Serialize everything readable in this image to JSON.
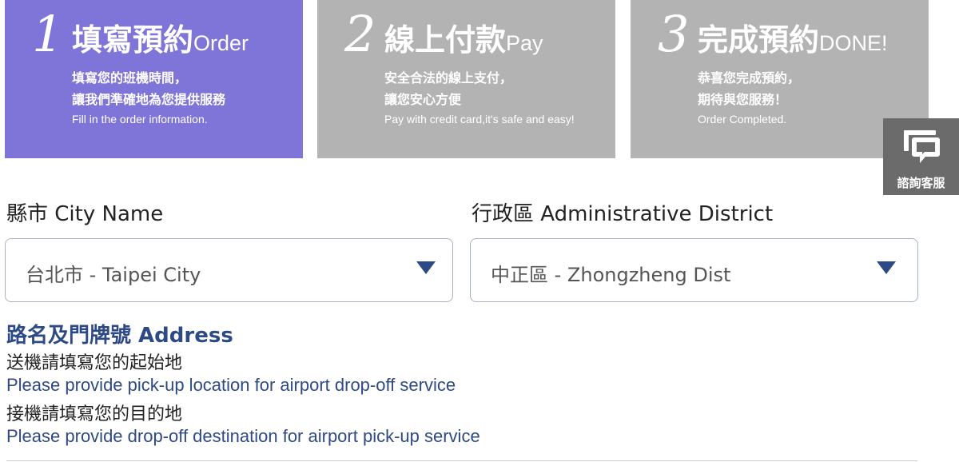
{
  "colors": {
    "active_step": "#7f75d8",
    "inactive_step": "#b3b3b3",
    "chat_button": "#6b6b6b",
    "accent": "#2e4a86"
  },
  "steps": [
    {
      "number": "1",
      "title_zh": "填寫預約",
      "title_en": "Order",
      "desc_line1": "填寫您的班機時間，",
      "desc_line2": "讓我們準確地為您提供服務",
      "desc_en": "Fill in the order information.",
      "active": true
    },
    {
      "number": "2",
      "title_zh": "線上付款",
      "title_en": "Pay",
      "desc_line1": "安全合法的線上支付，",
      "desc_line2": "讓您安心方便",
      "desc_en": "Pay with credit card,it's safe and easy!",
      "active": false
    },
    {
      "number": "3",
      "title_zh": "完成預約",
      "title_en": "DONE!",
      "desc_line1": "恭喜您完成預約，",
      "desc_line2": "期待與您服務！",
      "desc_en": "Order Completed.",
      "active": false
    }
  ],
  "chat": {
    "label": "諮詢客服",
    "icon": "chat-bubble-icon"
  },
  "form": {
    "city": {
      "label": "縣市 City Name",
      "value": "台北市 - Taipei City"
    },
    "district": {
      "label": "行政區 Administrative District",
      "value": "中正區 - Zhongzheng Dist"
    },
    "address": {
      "title": "路名及門牌號 Address",
      "note_dropoff_zh": "送機請填寫您的起始地",
      "note_dropoff_en": "Please provide pick-up location for airport drop-off service",
      "note_pickup_zh": "接機請填寫您的目的地",
      "note_pickup_en": "Please provide drop-off destination for airport pick-up service"
    }
  }
}
